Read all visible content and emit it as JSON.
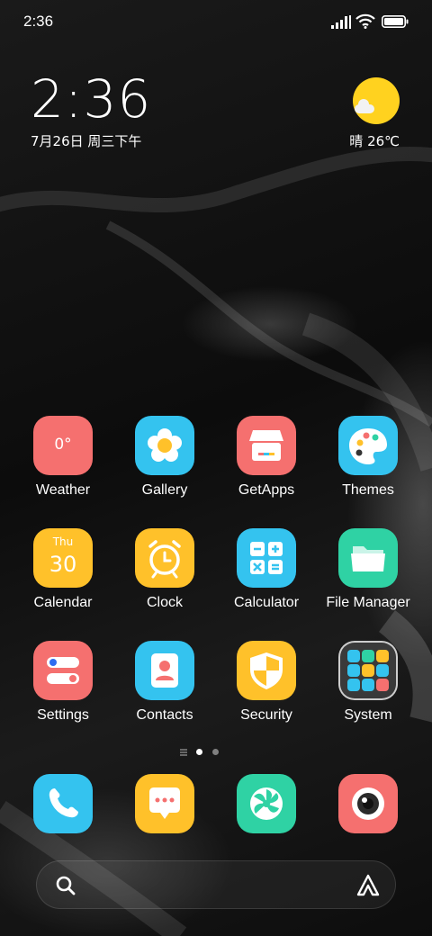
{
  "status_bar": {
    "time": "2:36"
  },
  "clock_widget": {
    "time": "2:36",
    "date": "7月26日 周三下午"
  },
  "weather_widget": {
    "text": "晴 26℃"
  },
  "apps": {
    "weather": {
      "label": "Weather",
      "icon_text": "0°"
    },
    "gallery": {
      "label": "Gallery"
    },
    "getapps": {
      "label": "GetApps"
    },
    "themes": {
      "label": "Themes"
    },
    "calendar": {
      "label": "Calendar",
      "day": "Thu",
      "date": "30"
    },
    "clock": {
      "label": "Clock"
    },
    "calculator": {
      "label": "Calculator"
    },
    "file_manager": {
      "label": "File Manager"
    },
    "settings": {
      "label": "Settings"
    },
    "contacts": {
      "label": "Contacts"
    },
    "security": {
      "label": "Security"
    },
    "system": {
      "label": "System"
    }
  },
  "page_indicator": {
    "pages": 2,
    "active": 1
  },
  "dock": [
    "phone-icon",
    "messages-icon",
    "browser-icon",
    "camera-icon"
  ],
  "colors": {
    "red": "#f5706f",
    "blue": "#34c3ef",
    "yellow": "#ffc12a",
    "green": "#2fd2a4"
  }
}
